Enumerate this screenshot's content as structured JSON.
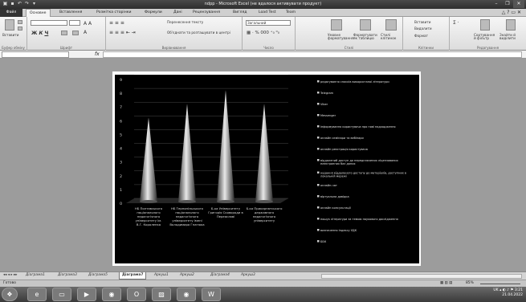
{
  "window": {
    "title": "ndpp - Microsoft Excel (не вдалося активувати продукт)"
  },
  "quick_access": {
    "save_icon": "save-icon",
    "undo_icon": "undo-icon",
    "redo_icon": "redo-icon"
  },
  "ribbon_tabs": [
    "Файл",
    "Основне",
    "Вставлення",
    "Розмітка сторінки",
    "Формули",
    "Дані",
    "Рецензування",
    "Вигляд",
    "Load Test",
    "Team"
  ],
  "ribbon": {
    "paste_label": "Вставити",
    "clipboard_group": "Буфер обміну",
    "font_group": "Шрифт",
    "alignment_group": "Вирівнювання",
    "number_group": "Число",
    "styles_group": "Стилі",
    "cells_group": "Клітинки",
    "editing_group": "Редагування",
    "wrap_text": "Перенесення тексту",
    "merge_center": "Об'єднати та розташувати в центрі",
    "number_format": "Загальний",
    "conditional_format": "Умовне форматування",
    "format_as_table": "Форматувати як таблицю",
    "cell_styles": "Стилі клітинок",
    "insert_cells": "Вставити",
    "delete_cells": "Видалити",
    "format_cells": "Формат",
    "sort_filter": "Сортування й фільтр",
    "find_select": "Знайти й виділити"
  },
  "formula_bar": {
    "name_box": "",
    "fx_label": "fx",
    "formula": ""
  },
  "chart_data": {
    "type": "bar",
    "categories": [
      "НБ Полтавського національного педагогічного університету ім. В.Г. Короленка",
      "НБ Тернопільського національного педагогічного університету імені Володимира Гнатюка",
      "Б-ка Університету Григорія Сковороди в Переяславі",
      "Б-ка Прикарпатського державного педагогічного університету"
    ],
    "values": [
      6,
      7,
      8,
      7
    ],
    "ylim": [
      0,
      9
    ],
    "yticks": [
      "0",
      "1",
      "2",
      "3",
      "4",
      "5",
      "6",
      "7",
      "8",
      "9"
    ],
    "grid": true,
    "legend_position": "right",
    "legend": [
      "редагування списків використаної літератури",
      "Telegram",
      "Viber",
      "Messenger",
      "інформування користувача про нові надходження",
      "онлайн семінари та вебінари",
      "онлайн реєстрація користувача",
      "віддалений доступ до передплачених ліцензованих електронних баз даних",
      "надання віддаленого доступу до матеріалів, доступних в локальній мережі",
      "онлайн-чат",
      "віртуальна довідка",
      "онлайн консультації",
      "пошук літератури за темою наукового дослідження",
      "визначення індексу УДК",
      "ББК"
    ]
  },
  "sheet_tabs": [
    "Діаграма1",
    "Діаграма3",
    "Діаграма5",
    "Діаграма7",
    "Аркуш1",
    "Аркуш2",
    "Діаграма4",
    "Аркуш3"
  ],
  "active_sheet_index": 3,
  "status": {
    "ready": "Готово",
    "zoom": "85%"
  },
  "taskbar": {
    "lang": "UK",
    "time": "3:21",
    "date": "21.04.2022",
    "start_icon": "windows-start-icon",
    "apps": [
      "ie-icon",
      "explorer-icon",
      "media-icon",
      "chrome-icon",
      "opera-icon",
      "photo-icon",
      "chrome-alt-icon",
      "word-icon"
    ]
  }
}
